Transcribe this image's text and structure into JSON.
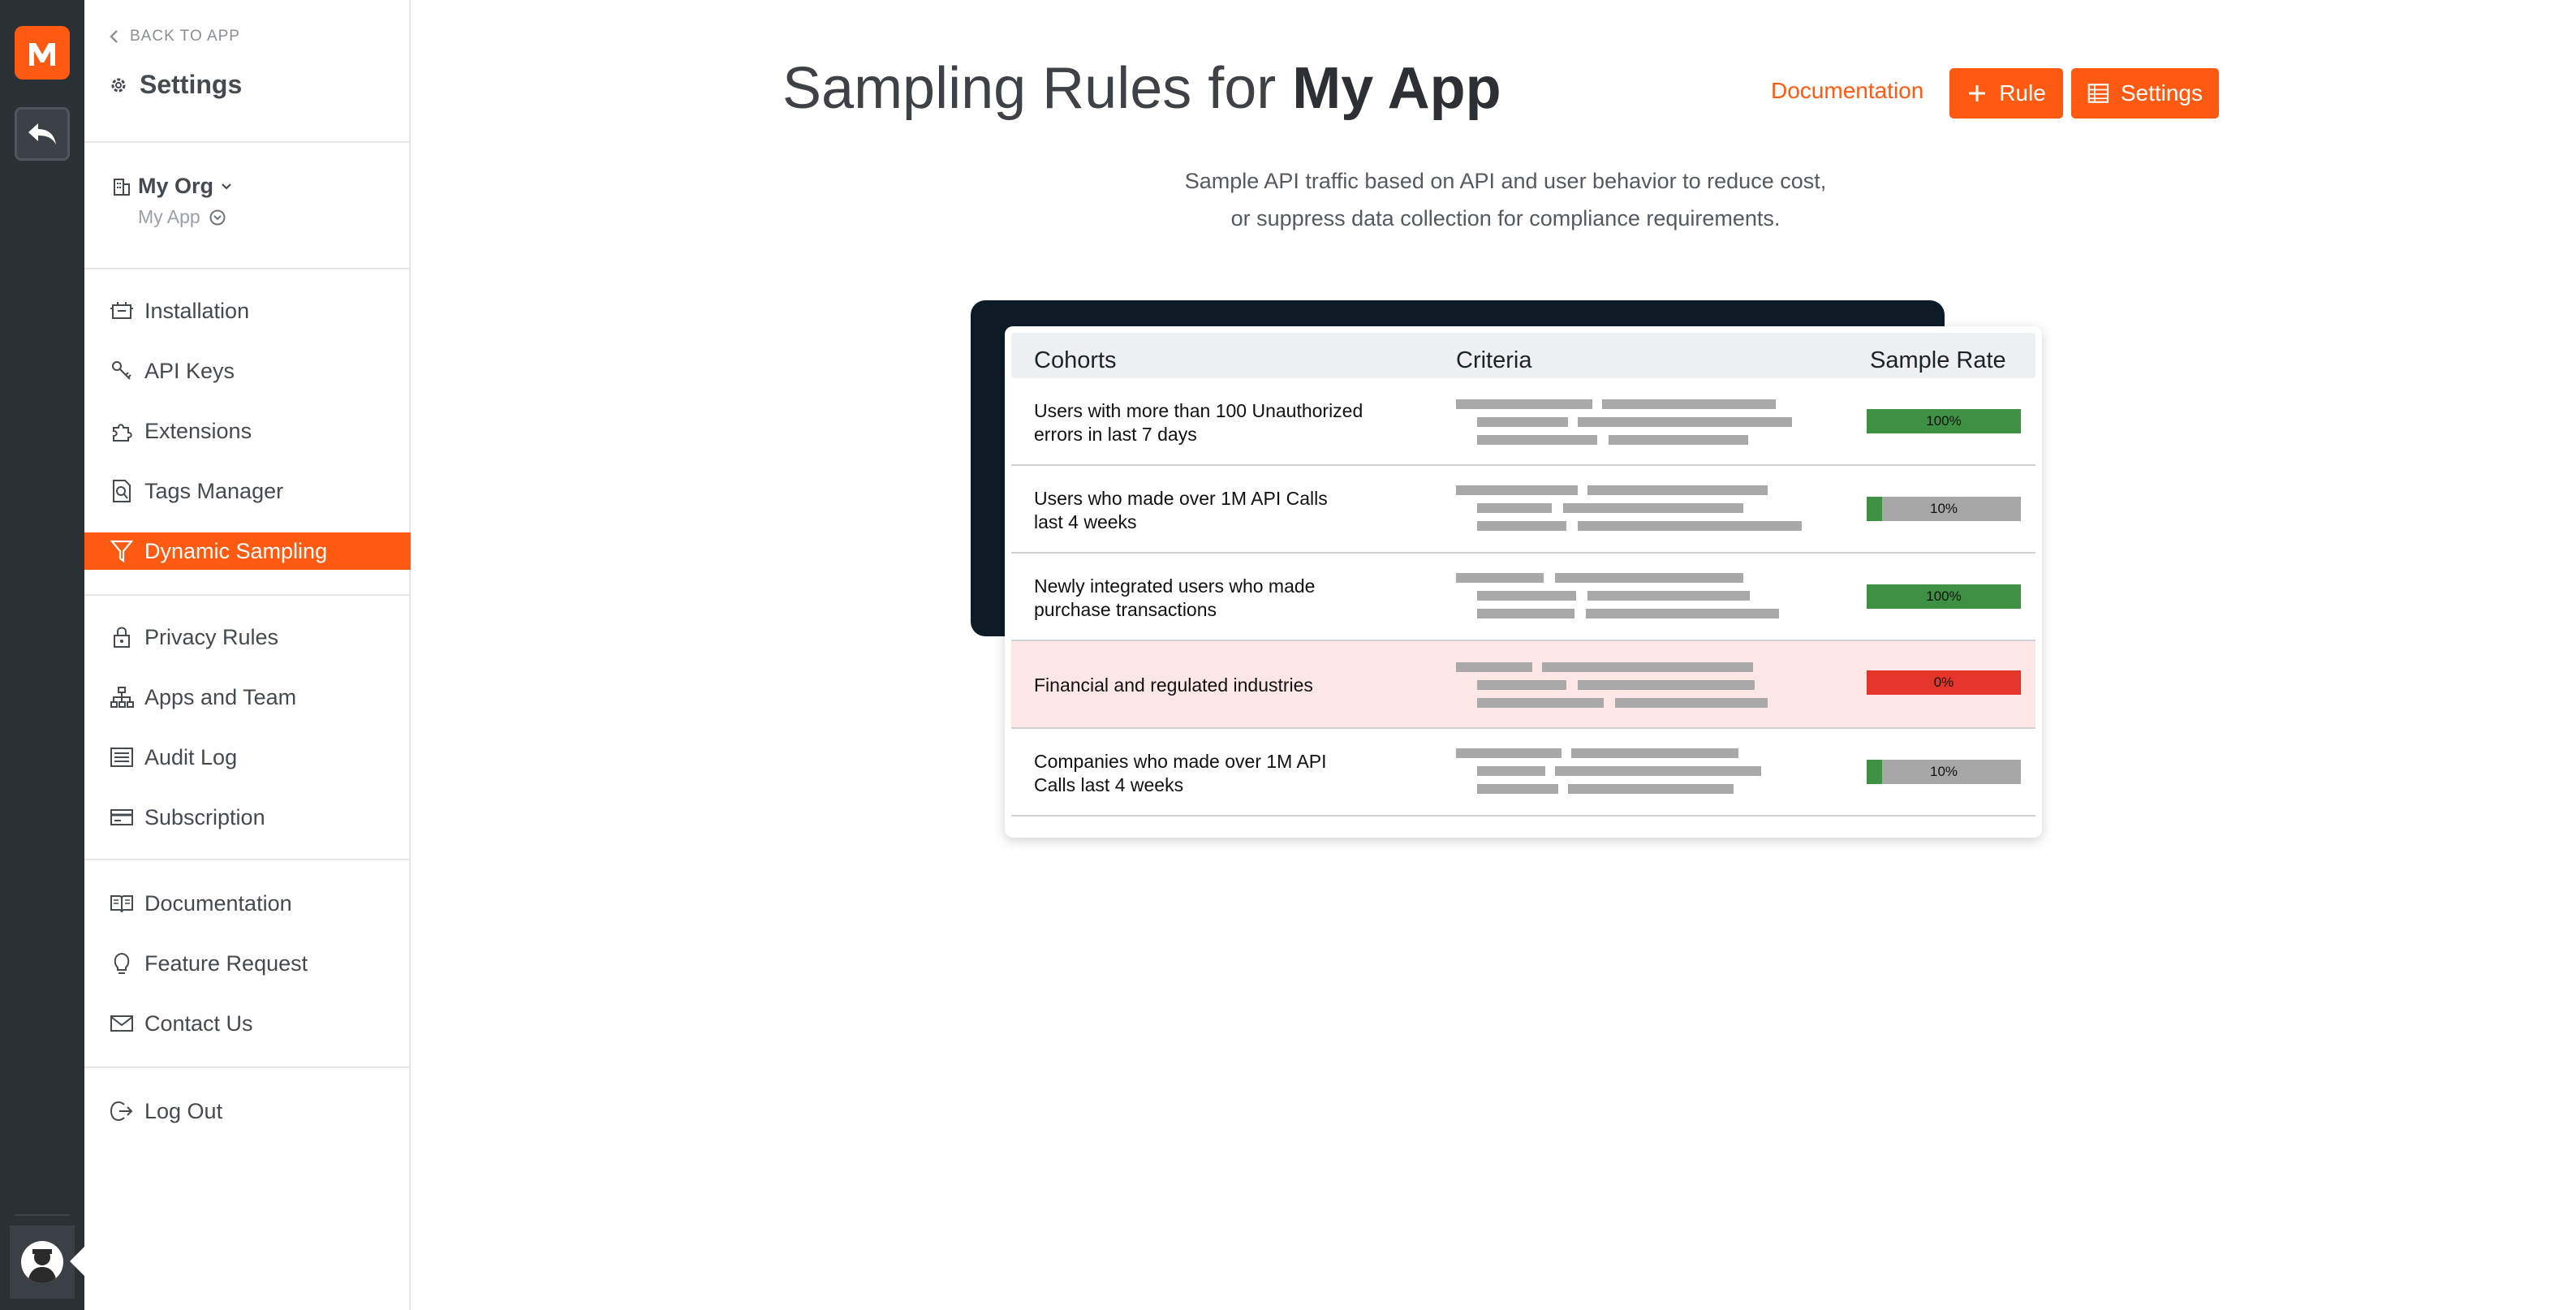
{
  "sidebar": {
    "back_label": "BACK TO APP",
    "title": "Settings",
    "org_name": "My Org",
    "app_name": "My App",
    "items": [
      {
        "label": "Installation",
        "icon": "installation-icon"
      },
      {
        "label": "API Keys",
        "icon": "key-icon"
      },
      {
        "label": "Extensions",
        "icon": "puzzle-icon"
      },
      {
        "label": "Tags Manager",
        "icon": "tags-search-icon"
      },
      {
        "label": "Dynamic Sampling",
        "icon": "filter-icon",
        "active": true
      },
      {
        "label": "Privacy Rules",
        "icon": "lock-icon"
      },
      {
        "label": "Apps and Team",
        "icon": "org-chart-icon"
      },
      {
        "label": "Audit Log",
        "icon": "list-icon"
      },
      {
        "label": "Subscription",
        "icon": "credit-card-icon"
      },
      {
        "label": "Documentation",
        "icon": "book-icon"
      },
      {
        "label": "Feature Request",
        "icon": "lightbulb-icon"
      },
      {
        "label": "Contact Us",
        "icon": "mail-icon"
      },
      {
        "label": "Log Out",
        "icon": "logout-icon"
      }
    ]
  },
  "header": {
    "title_prefix": "Sampling Rules for ",
    "title_app": "My App",
    "documentation_label": "Documentation",
    "rule_button_label": "Rule",
    "settings_button_label": "Settings"
  },
  "description": {
    "line1": "Sample API traffic based on API and user behavior to reduce cost,",
    "line2": "or suppress data collection for compliance requirements."
  },
  "illustration": {
    "columns": [
      "Cohorts",
      "Criteria",
      "Sample Rate"
    ],
    "rows": [
      {
        "cohort_line1": "Users with more than 100 Unauthorized",
        "cohort_line2": "errors in last 7 days",
        "rate_label": "100%",
        "rate_fraction": 1.0,
        "color": "#3e9142"
      },
      {
        "cohort_line1": "Users who made over 1M API Calls",
        "cohort_line2": "last 4 weeks",
        "rate_label": "10%",
        "rate_fraction": 0.1,
        "color": "#3e9142"
      },
      {
        "cohort_line1": "Newly integrated users who made",
        "cohort_line2": "purchase transactions",
        "rate_label": "100%",
        "rate_fraction": 1.0,
        "color": "#3e9142"
      },
      {
        "cohort_line1": "Financial and regulated industries",
        "cohort_line2": "",
        "rate_label": "0%",
        "rate_fraction": 1.0,
        "color": "#e5352b",
        "highlight": true
      },
      {
        "cohort_line1": "Companies who made over 1M API",
        "cohort_line2": "Calls last 4 weeks",
        "rate_label": "10%",
        "rate_fraction": 0.1,
        "color": "#3e9142"
      }
    ]
  },
  "colors": {
    "accent": "#ff5a12",
    "rail": "#2b3035",
    "illustration_dark": "#0d1b26",
    "success": "#3e9142",
    "danger": "#e5352b"
  }
}
